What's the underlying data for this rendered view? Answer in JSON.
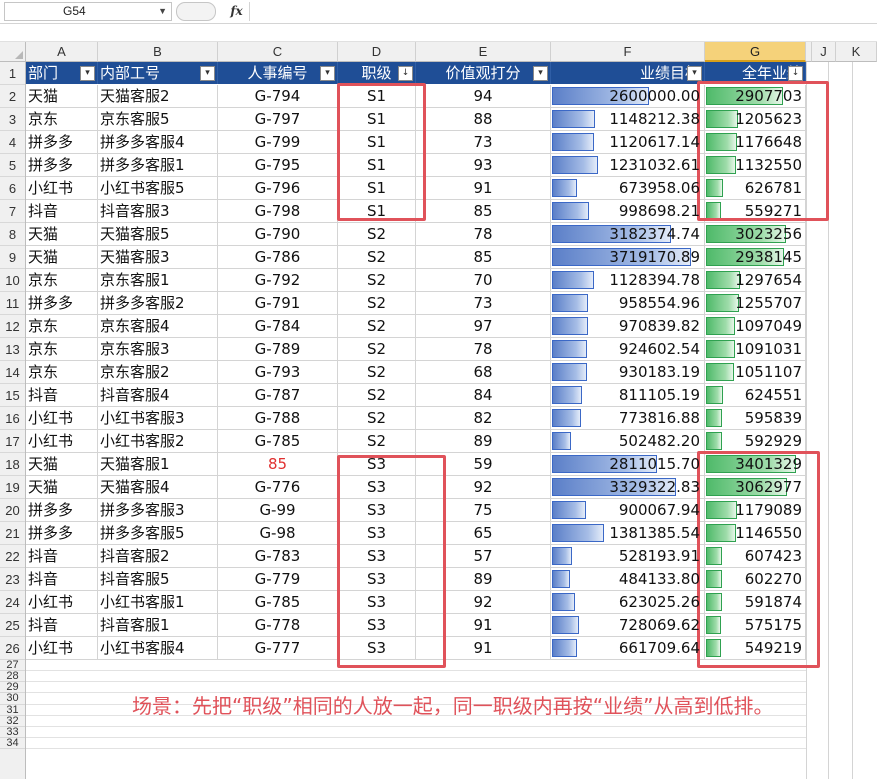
{
  "formula_bar": {
    "name_box": "G54",
    "fx_label": "fx",
    "formula": ""
  },
  "column_letters": [
    "A",
    "B",
    "C",
    "D",
    "E",
    "F",
    "G",
    "",
    "J",
    "K"
  ],
  "header": [
    "部门",
    "内部工号",
    "人事编号",
    "职级",
    "价值观打分",
    "业绩目标",
    "全年业绩"
  ],
  "rows": [
    [
      "天猫",
      "天猫客服2",
      "G-794",
      "S1",
      "94",
      "2600000.00",
      "2907703"
    ],
    [
      "京东",
      "京东客服5",
      "G-797",
      "S1",
      "88",
      "1148212.38",
      "1205623"
    ],
    [
      "拼多多",
      "拼多多客服4",
      "G-799",
      "S1",
      "73",
      "1120617.14",
      "1176648"
    ],
    [
      "拼多多",
      "拼多多客服1",
      "G-795",
      "S1",
      "93",
      "1231032.61",
      "1132550"
    ],
    [
      "小红书",
      "小红书客服5",
      "G-796",
      "S1",
      "91",
      "673958.06",
      "626781"
    ],
    [
      "抖音",
      "抖音客服3",
      "G-798",
      "S1",
      "85",
      "998698.21",
      "559271"
    ],
    [
      "天猫",
      "天猫客服5",
      "G-790",
      "S2",
      "78",
      "3182374.74",
      "3023256"
    ],
    [
      "天猫",
      "天猫客服3",
      "G-786",
      "S2",
      "85",
      "3719170.89",
      "2938145"
    ],
    [
      "京东",
      "京东客服1",
      "G-792",
      "S2",
      "70",
      "1128394.78",
      "1297654"
    ],
    [
      "拼多多",
      "拼多多客服2",
      "G-791",
      "S2",
      "73",
      "958554.96",
      "1255707"
    ],
    [
      "京东",
      "京东客服4",
      "G-784",
      "S2",
      "97",
      "970839.82",
      "1097049"
    ],
    [
      "京东",
      "京东客服3",
      "G-789",
      "S2",
      "78",
      "924602.54",
      "1091031"
    ],
    [
      "京东",
      "京东客服2",
      "G-793",
      "S2",
      "68",
      "930183.19",
      "1051107"
    ],
    [
      "抖音",
      "抖音客服4",
      "G-787",
      "S2",
      "84",
      "811105.19",
      "624551"
    ],
    [
      "小红书",
      "小红书客服3",
      "G-788",
      "S2",
      "82",
      "773816.88",
      "595839"
    ],
    [
      "小红书",
      "小红书客服2",
      "G-785",
      "S2",
      "89",
      "502482.20",
      "592929"
    ],
    [
      "天猫",
      "天猫客服1",
      "85",
      "S3",
      "59",
      "2811015.70",
      "3401329"
    ],
    [
      "天猫",
      "天猫客服4",
      "G-776",
      "S3",
      "92",
      "3329322.83",
      "3062977"
    ],
    [
      "拼多多",
      "拼多多客服3",
      "G-99",
      "S3",
      "75",
      "900067.94",
      "1179089"
    ],
    [
      "拼多多",
      "拼多多客服5",
      "G-98",
      "S3",
      "65",
      "1381385.54",
      "1146550"
    ],
    [
      "抖音",
      "抖音客服2",
      "G-783",
      "S3",
      "57",
      "528193.91",
      "607423"
    ],
    [
      "抖音",
      "抖音客服5",
      "G-779",
      "S3",
      "89",
      "484133.80",
      "602270"
    ],
    [
      "小红书",
      "小红书客服1",
      "G-785",
      "S3",
      "92",
      "623025.26",
      "591874"
    ],
    [
      "抖音",
      "抖音客服1",
      "G-778",
      "S3",
      "91",
      "728069.62",
      "575175"
    ],
    [
      "小红书",
      "小红书客服4",
      "G-777",
      "S3",
      "91",
      "661709.64",
      "549219"
    ]
  ],
  "red_cells": [
    [
      16,
      2
    ]
  ],
  "extra_row_numbers": [
    "27",
    "28",
    "29",
    "30",
    "31",
    "32",
    "33",
    "34"
  ],
  "note": "场景：先把“职级”相同的人放一起，同一职级内再按“业绩”从高到低排。",
  "colors": {
    "header_bg": "#1f4e96",
    "bar_blue": "#5b7fc8",
    "bar_green": "#4fba6a",
    "annotation_red": "#e0525a",
    "selected_col": "#f5d27a"
  }
}
